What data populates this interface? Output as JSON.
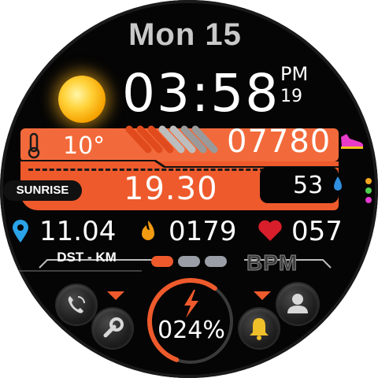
{
  "date": {
    "text": "Mon 15"
  },
  "time": {
    "hours_minutes": "03:58",
    "ampm": "PM",
    "seconds": "19"
  },
  "weather": {
    "icon": "sun-icon",
    "temperature": "10°"
  },
  "steps": {
    "value": "07780",
    "icon": "shoe-icon"
  },
  "sunrise": {
    "label": "SUNRISE",
    "time": "19.30"
  },
  "humidity": {
    "value": "53",
    "icon": "water-drop-icon"
  },
  "distance": {
    "value": "11.04",
    "label": "DST - KM",
    "icon": "location-pin-icon"
  },
  "calories": {
    "value": "0179",
    "icon": "flame-icon"
  },
  "heart": {
    "value": "057",
    "label": "BPM",
    "icon": "heart-icon"
  },
  "battery": {
    "value": "024%",
    "icon": "lightning-icon",
    "level": 0.24
  },
  "shortcuts": [
    "phone-icon",
    "wrench-icon",
    "bell-icon",
    "person-icon"
  ],
  "colors": {
    "accent": "#ee5a2c",
    "dots": [
      "#f2a51f",
      "#4fd04f",
      "#e23ad0"
    ]
  }
}
